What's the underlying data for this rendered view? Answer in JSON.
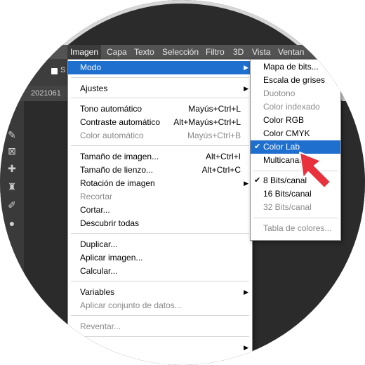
{
  "menubar": {
    "items": [
      "Imagen",
      "Capa",
      "Texto",
      "Selección",
      "Filtro",
      "3D",
      "Vista",
      "Ventan"
    ]
  },
  "options_bar": {
    "checkbox_label": "S"
  },
  "document_tab": {
    "label": "2021061"
  },
  "image_menu": {
    "modo": "Modo",
    "ajustes": "Ajustes",
    "tono_auto": {
      "label": "Tono automático",
      "shortcut": "Mayús+Ctrl+L"
    },
    "contraste_auto": {
      "label": "Contraste automático",
      "shortcut": "Alt+Mayús+Ctrl+L"
    },
    "color_auto": {
      "label": "Color automático",
      "shortcut": "Mayús+Ctrl+B"
    },
    "tamano_imagen": {
      "label": "Tamaño de imagen...",
      "shortcut": "Alt+Ctrl+I"
    },
    "tamano_lienzo": {
      "label": "Tamaño de lienzo...",
      "shortcut": "Alt+Ctrl+C"
    },
    "rotacion": "Rotación de imagen",
    "recortar": "Recortar",
    "cortar": "Cortar...",
    "descubrir": "Descubrir todas",
    "duplicar": "Duplicar...",
    "aplicar_imagen": "Aplicar imagen...",
    "calcular": "Calcular...",
    "variables": "Variables",
    "aplicar_conjunto": "Aplicar conjunto de datos...",
    "reventar": "Reventar..."
  },
  "mode_submenu": {
    "mapa_bits": "Mapa de bits...",
    "escala_grises": "Escala de grises",
    "duotono": "Duotono",
    "color_indexado": "Color indexado",
    "color_rgb": "Color RGB",
    "color_cmyk": "Color CMYK",
    "color_lab": "Color Lab",
    "multicanal": "Multicanal",
    "bits8": "8 Bits/canal",
    "bits16": "16 Bits/canal",
    "bits32": "32 Bits/canal",
    "tabla_colores": "Tabla de colores..."
  },
  "colors": {
    "highlight": "#1f6fce",
    "pointer": "#e8313c",
    "disabled": "#8a8a8a"
  }
}
